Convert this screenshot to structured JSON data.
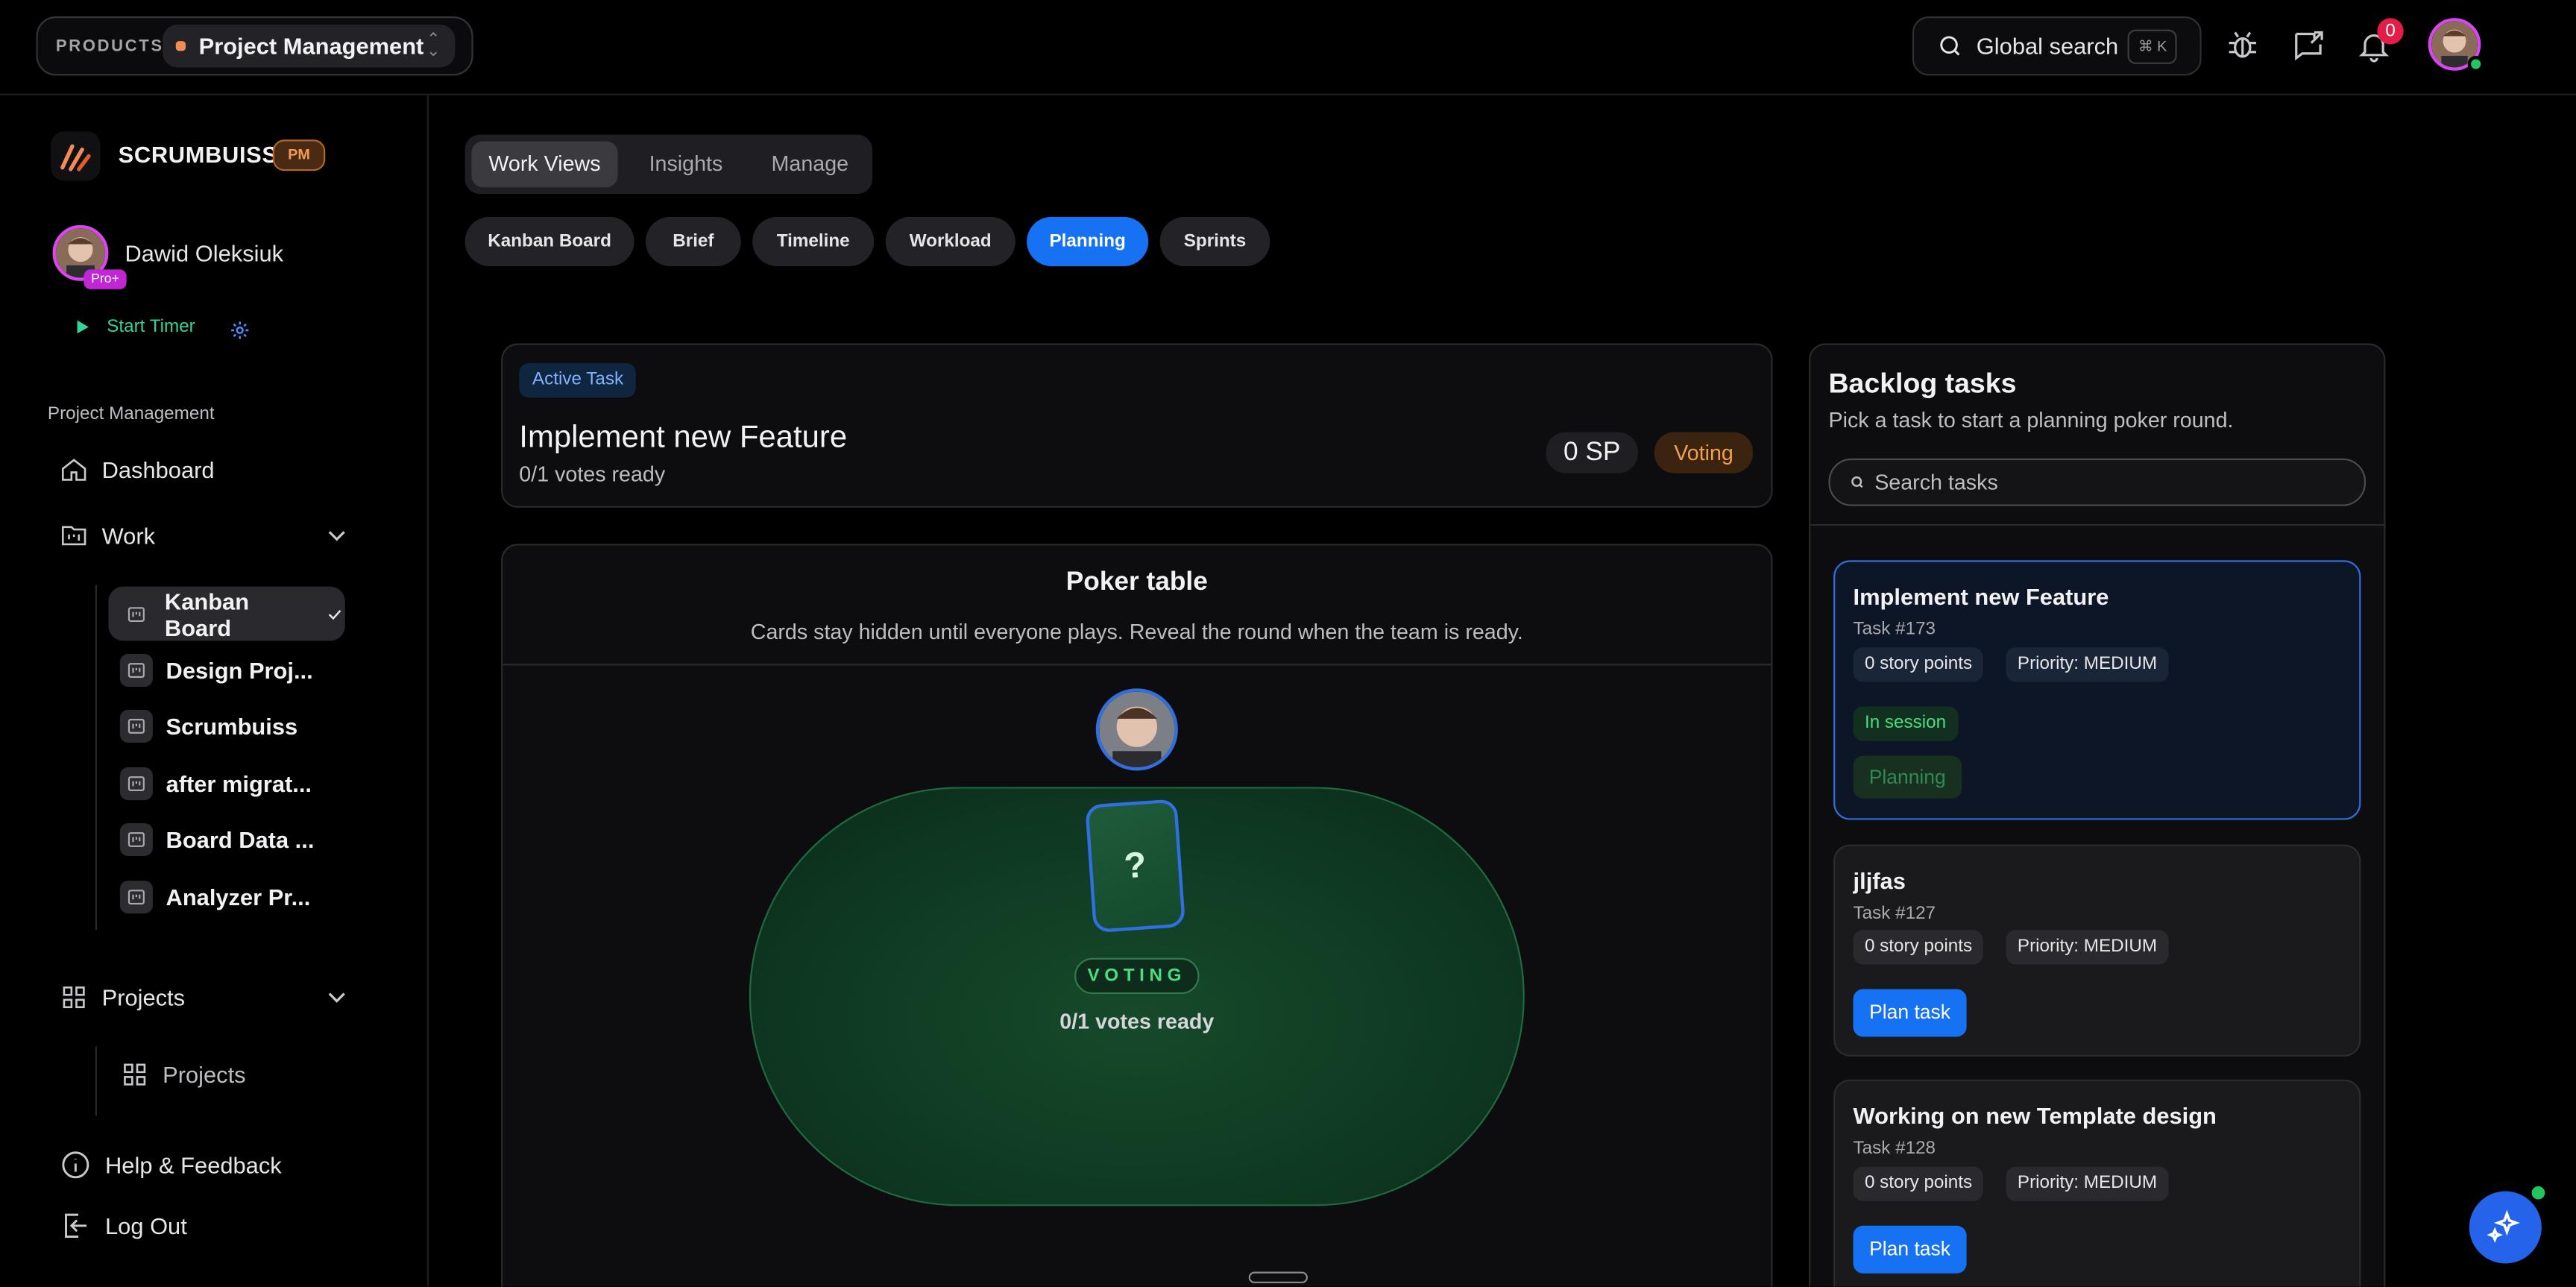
{
  "colors": {
    "accent": "#1672f3",
    "success": "#22c55e",
    "warning": "#f0a24a",
    "brand": "#f38b56",
    "badge": "#d946ef"
  },
  "topbar": {
    "products_label": "PRODUCTS",
    "product_name": "Project Management",
    "search_label": "Global search",
    "search_shortcut": "⌘ K",
    "notification_count": "0",
    "icons": [
      "bug-icon",
      "feedback-icon",
      "bell-icon"
    ]
  },
  "sidebar": {
    "brand_name": "SCRUMBUISS",
    "brand_badge": "PM",
    "user_name": "Dawid Oleksiuk",
    "user_badge": "Pro+",
    "start_timer": "Start Timer",
    "section_label": "Project Management",
    "nav": {
      "dashboard": "Dashboard",
      "work": "Work",
      "projects": "Projects",
      "projects_child": "Projects",
      "help": "Help & Feedback",
      "logout": "Log Out"
    },
    "boards": [
      "Kanban Board",
      "Design Proj...",
      "Scrumbuiss",
      "after migrat...",
      "Board Data ...",
      "Analyzer Pr..."
    ]
  },
  "view_tabs": [
    "Work Views",
    "Insights",
    "Manage"
  ],
  "view_chips": [
    "Kanban Board",
    "Brief",
    "Timeline",
    "Workload",
    "Planning",
    "Sprints"
  ],
  "active_task": {
    "pill": "Active Task",
    "title": "Implement new Feature",
    "votes": "0/1 votes ready",
    "points": "0 SP",
    "status": "Voting"
  },
  "poker": {
    "title": "Poker table",
    "subtitle": "Cards stay hidden until everyone plays. Reveal the round when the team is ready.",
    "card_value": "?",
    "badge": "VOTING",
    "votes": "0/1 votes ready"
  },
  "backlog": {
    "title": "Backlog tasks",
    "subtitle": "Pick a task to start a planning poker round.",
    "search_placeholder": "Search tasks",
    "tasks": [
      {
        "title": "Implement new Feature",
        "id": "Task #173",
        "points": "0 story points",
        "priority": "Priority: MEDIUM",
        "session": "In session",
        "action": "Planning"
      },
      {
        "title": "jljfas",
        "id": "Task #127",
        "points": "0 story points",
        "priority": "Priority: MEDIUM",
        "action": "Plan task"
      },
      {
        "title": "Working on new Template design",
        "id": "Task #128",
        "points": "0 story points",
        "priority": "Priority: MEDIUM",
        "action": "Plan task"
      }
    ]
  }
}
